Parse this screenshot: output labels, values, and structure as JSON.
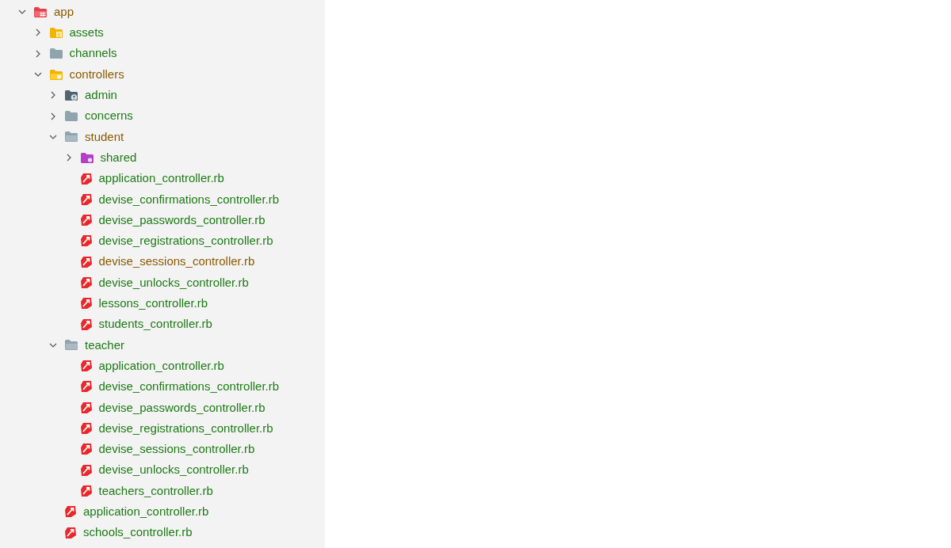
{
  "tree": [
    {
      "label": "app",
      "kind": "app",
      "expanded": true,
      "color": "#8a5a00",
      "children": [
        {
          "label": "assets",
          "kind": "assets",
          "expanded": false,
          "color": "#1e7b16"
        },
        {
          "label": "channels",
          "kind": "folder",
          "expanded": false,
          "color": "#1e7b16"
        },
        {
          "label": "controllers",
          "kind": "controllers",
          "expanded": true,
          "color": "#8a5a00",
          "children": [
            {
              "label": "admin",
              "kind": "admin",
              "expanded": false,
              "color": "#1e7b16"
            },
            {
              "label": "concerns",
              "kind": "folder",
              "expanded": false,
              "color": "#1e7b16"
            },
            {
              "label": "student",
              "kind": "folder",
              "expanded": true,
              "color": "#8a5a00",
              "children": [
                {
                  "label": "shared",
                  "kind": "shared",
                  "expanded": false,
                  "color": "#1e7b16"
                },
                {
                  "label": "application_controller.rb",
                  "kind": "file",
                  "color": "#1e7b16"
                },
                {
                  "label": "devise_confirmations_controller.rb",
                  "kind": "file",
                  "color": "#1e7b16"
                },
                {
                  "label": "devise_passwords_controller.rb",
                  "kind": "file",
                  "color": "#1e7b16"
                },
                {
                  "label": "devise_registrations_controller.rb",
                  "kind": "file",
                  "color": "#1e7b16"
                },
                {
                  "label": "devise_sessions_controller.rb",
                  "kind": "file",
                  "color": "#8a5a00"
                },
                {
                  "label": "devise_unlocks_controller.rb",
                  "kind": "file",
                  "color": "#1e7b16"
                },
                {
                  "label": "lessons_controller.rb",
                  "kind": "file",
                  "color": "#1e7b16"
                },
                {
                  "label": "students_controller.rb",
                  "kind": "file",
                  "color": "#1e7b16"
                }
              ]
            },
            {
              "label": "teacher",
              "kind": "folder",
              "expanded": true,
              "color": "#1e7b16",
              "children": [
                {
                  "label": "application_controller.rb",
                  "kind": "file",
                  "color": "#1e7b16"
                },
                {
                  "label": "devise_confirmations_controller.rb",
                  "kind": "file",
                  "color": "#1e7b16"
                },
                {
                  "label": "devise_passwords_controller.rb",
                  "kind": "file",
                  "color": "#1e7b16"
                },
                {
                  "label": "devise_registrations_controller.rb",
                  "kind": "file",
                  "color": "#1e7b16"
                },
                {
                  "label": "devise_sessions_controller.rb",
                  "kind": "file",
                  "color": "#1e7b16"
                },
                {
                  "label": "devise_unlocks_controller.rb",
                  "kind": "file",
                  "color": "#1e7b16"
                },
                {
                  "label": "teachers_controller.rb",
                  "kind": "file",
                  "color": "#1e7b16"
                }
              ]
            },
            {
              "label": "application_controller.rb",
              "kind": "file",
              "color": "#1e7b16"
            },
            {
              "label": "schools_controller.rb",
              "kind": "file",
              "color": "#1e7b16"
            }
          ]
        }
      ]
    }
  ]
}
